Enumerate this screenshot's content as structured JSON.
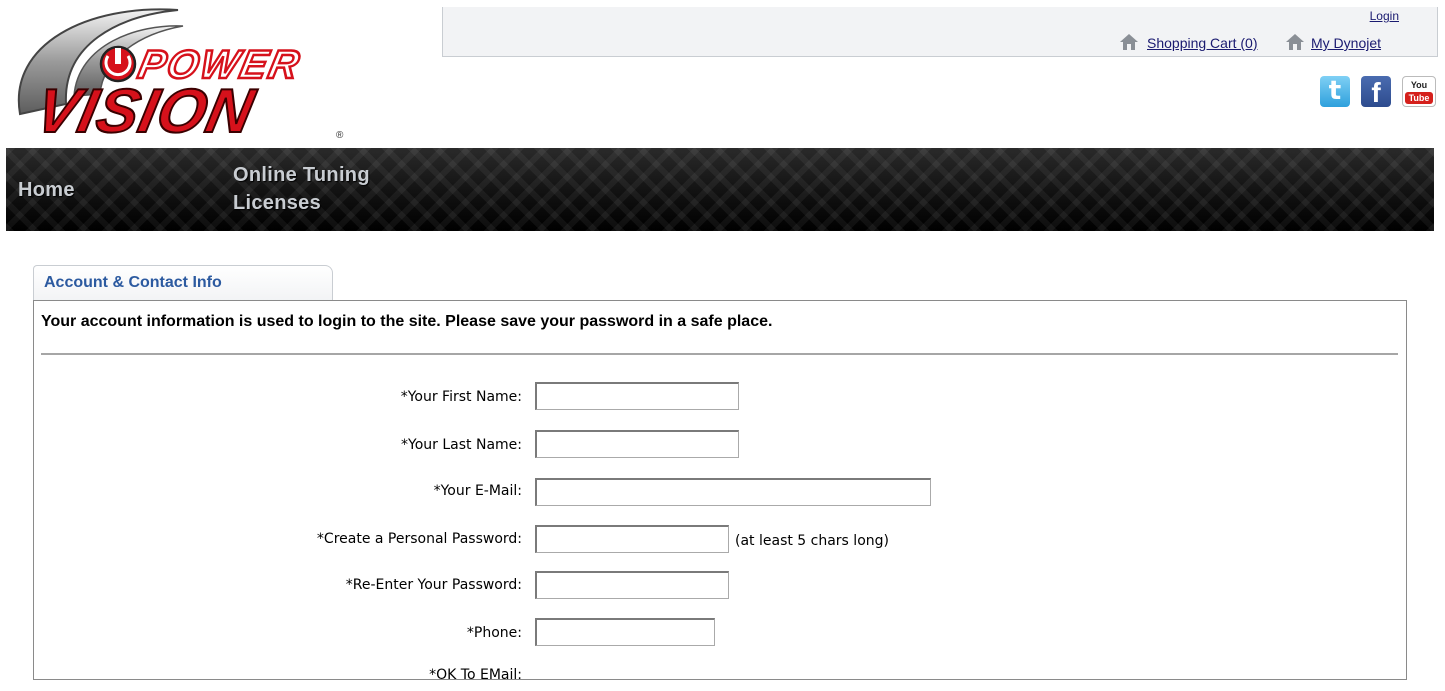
{
  "header": {
    "logo": {
      "top_text": "POWER",
      "bottom_text": "VISION",
      "registered": "®"
    },
    "login_label": "Login",
    "cart_label": "Shopping Cart (0)",
    "dynojet_label": "My Dynojet",
    "social": {
      "twitter": "t",
      "facebook": "f",
      "youtube_top": "You",
      "youtube_bottom": "Tube"
    }
  },
  "nav": {
    "home_label": "Home",
    "online_tuning_label": "Online Tuning Licenses"
  },
  "form": {
    "tab_label": "Account & Contact Info",
    "intro": "Your account information is used to login to the site. Please save your password in a safe place.",
    "first_name_label": "*Your First Name:",
    "last_name_label": "*Your Last Name:",
    "email_label": "*Your E-Mail:",
    "password_label": "*Create a Personal Password:",
    "password_hint": "(at least 5 chars long)",
    "reenter_label": "*Re-Enter Your Password:",
    "phone_label": "*Phone:",
    "ok_email_label": "*OK To EMail:",
    "first_name_value": "",
    "last_name_value": "",
    "email_value": "",
    "password_value": "",
    "reenter_value": "",
    "phone_value": ""
  },
  "colors": {
    "tab_text": "#2c5aa0",
    "link": "#1a1a70",
    "logo_red": "#d6111b",
    "nav_text": "#c9cdd2"
  }
}
